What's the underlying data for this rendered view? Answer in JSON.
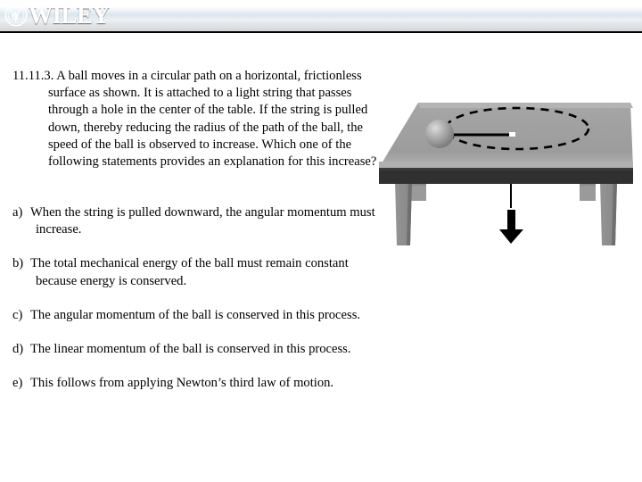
{
  "header": {
    "brand_name": "WILEY",
    "emblem_icon": "wiley-seal-icon",
    "gradient_top": "#141f2b",
    "gradient_mid": "#3a5567",
    "gradient_bottom": "#16202a"
  },
  "question": {
    "number": "11.11.3.",
    "text": "A ball moves in a circular path on a horizontal, frictionless surface as shown.  It is attached to a light string that passes through a hole in the center of the table.  If the string is pulled down, thereby reducing the radius of the path of the ball, the speed of the ball is observed to increase.  Which one of the following statements provides an explanation for this increase?"
  },
  "choices": [
    {
      "marker": "a)",
      "text": "When the string is pulled downward, the angular momentum must increase."
    },
    {
      "marker": "b)",
      "text": "The total mechanical energy of the ball must remain constant because energy is conserved."
    },
    {
      "marker": "c)",
      "text": "The angular momentum of the ball is conserved in this process."
    },
    {
      "marker": "d)",
      "text": "The linear momentum of the ball is conserved in this process."
    },
    {
      "marker": "e)",
      "text": "This follows from applying Newton’s third law of motion."
    }
  ],
  "illustration": {
    "name": "table-with-orbiting-ball-diagram",
    "parts": {
      "table_top": "table-top-surface",
      "table_edge": "table-edge-band",
      "front_left_leg": "table-front-left-leg",
      "front_right_leg": "table-front-right-leg",
      "back_left_leg": "table-back-left-leg",
      "back_right_leg": "table-back-right-leg",
      "circular_path": "dashed-circular-path",
      "ball": "ball",
      "string": "string-segment",
      "hole": "center-hole",
      "pull_arrow": "downward-pull-arrow"
    },
    "colors": {
      "table_top": "#9e9e9e",
      "table_top_light": "#b4b4b4",
      "table_edge": "#303030",
      "leg": "#8d8d8d",
      "leg_shade": "#6f6f6f",
      "ball_highlight": "#d8d8d8",
      "ball_base": "#8a8a8a",
      "path_stroke": "#000000",
      "arrow": "#000000"
    }
  }
}
